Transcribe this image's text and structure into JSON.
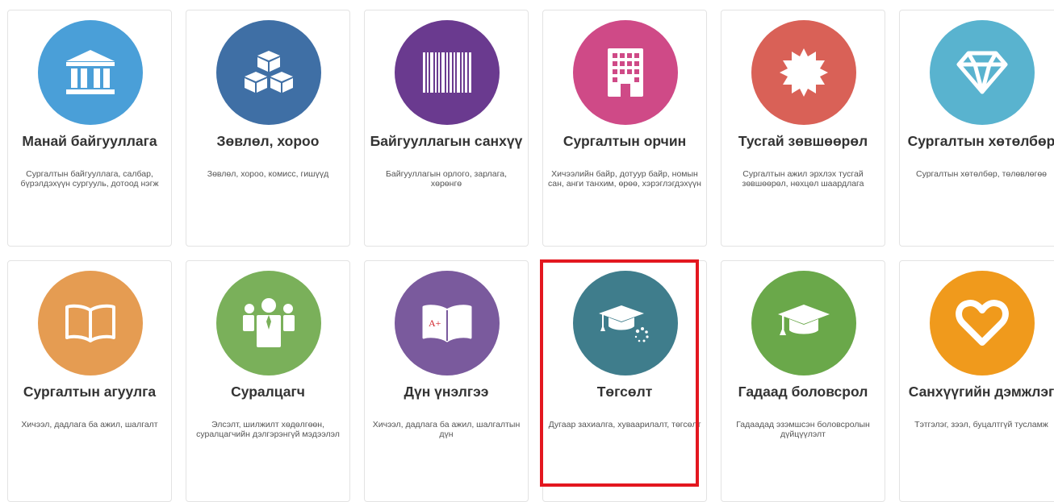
{
  "cards": [
    {
      "title": "Манай байгууллага",
      "desc": "Сургалтын байгууллага, салбар, бүрэлдэхүүн сургууль, дотоод нэгж",
      "color": "#4a9fd8",
      "icon": "institution-icon"
    },
    {
      "title": "Зөвлөл, хороо",
      "desc": "Зөвлөл, хороо, комисс, гишүүд",
      "color": "#3f6fa5",
      "icon": "cubes-icon"
    },
    {
      "title": "Байгууллагын санхүү",
      "desc": "Байгууллагын орлого, зарлага, хөрөнгө",
      "color": "#6a3a8f",
      "icon": "barcode-icon"
    },
    {
      "title": "Сургалтын орчин",
      "desc": "Хичээлийн байр, дотуур байр, номын сан, анги танхим, өрөө, хэрэглэгдэхүүн",
      "color": "#cf4a87",
      "icon": "building-icon"
    },
    {
      "title": "Тусгай зөвшөөрөл",
      "desc": "Сургалтын ажил эрхлэх тусгай зөвшөөрөл, нөхцөл шаардлага",
      "color": "#d96157",
      "icon": "certificate-icon"
    },
    {
      "title": "Сургалтын хөтөлбөр",
      "desc": "Сургалтын хөтөлбөр, төлөвлөгөө",
      "color": "#59b3cf",
      "icon": "diamond-icon"
    },
    {
      "title": "Сургалтын агуулга",
      "desc": "Хичээл, дадлага ба ажил, шалгалт",
      "color": "#e59c52",
      "icon": "book-icon"
    },
    {
      "title": "Суралцагч",
      "desc": "Элсэлт, шилжилт хөдөлгөөн, суралцагчийн дэлгэрэнгүй мэдээлэл",
      "color": "#7ab05a",
      "icon": "students-icon"
    },
    {
      "title": "Дүн үнэлгээ",
      "desc": "Хичээл, дадлага ба ажил, шалгалтын дүн",
      "color": "#7a5a9d",
      "icon": "grade-book-icon"
    },
    {
      "title": "Төгсөлт",
      "desc": "Дугаар захиалга, хуваарилалт, төгсөлт",
      "color": "#3f7d8c",
      "icon": "graduation-cap-loading-icon"
    },
    {
      "title": "Гадаад боловсрол",
      "desc": "Гадаадад эзэмшсэн боловсролын дүйцүүлэлт",
      "color": "#6aa84a",
      "icon": "graduation-cap-icon"
    },
    {
      "title": "Санхүүгийн дэмжлэг",
      "desc": "Тэтгэлэг, зээл, буцалтгүй тусламж",
      "color": "#f09a1c",
      "icon": "heart-icon"
    }
  ]
}
